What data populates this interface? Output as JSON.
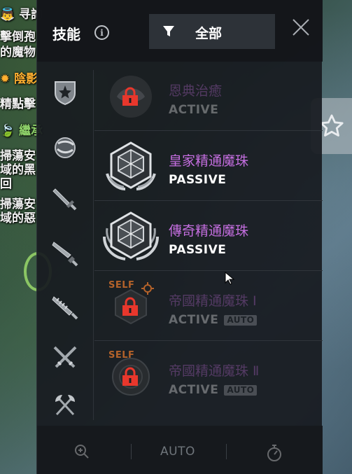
{
  "background": {
    "lines": [
      {
        "text": "👼 寻詢",
        "color": "white"
      },
      {
        "text": "擊倒孢",
        "color": "white"
      },
      {
        "text": "的魔物",
        "color": "white"
      },
      {
        "text": "✹ 陰影",
        "color": "orange"
      },
      {
        "text": "精點擊",
        "color": "white"
      },
      {
        "text": "🍃 繼承",
        "color": "green"
      },
      {
        "text": "掃蕩安",
        "color": "white"
      },
      {
        "text": "域的黑",
        "color": "white"
      },
      {
        "text": "回",
        "color": "white"
      },
      {
        "text": "掃蕩安",
        "color": "white"
      },
      {
        "text": "域的惡",
        "color": "white"
      }
    ]
  },
  "panel": {
    "title": "技能",
    "filter_label": "全部",
    "icons": {
      "info": "info-icon",
      "filter": "funnel-icon",
      "close": "close-icon",
      "side_tab": "star-icon"
    }
  },
  "categories": [
    {
      "name": "category-shield",
      "icon": "shield-icon"
    },
    {
      "name": "category-orb",
      "icon": "orb-icon"
    },
    {
      "name": "category-dagger",
      "icon": "dagger-icon"
    },
    {
      "name": "category-sword",
      "icon": "sword-icon"
    },
    {
      "name": "category-serrated-blade",
      "icon": "serrated-blade-icon"
    },
    {
      "name": "category-crossed-swords",
      "icon": "crossed-swords-icon"
    },
    {
      "name": "category-crossed-axes",
      "icon": "crossed-axes-icon"
    }
  ],
  "skills": [
    {
      "name": "恩典治癒",
      "type": "ACTIVE",
      "locked": true,
      "self": "",
      "auto": ""
    },
    {
      "name": "皇家精通魔珠",
      "type": "PASSIVE",
      "locked": false,
      "self": "",
      "auto": ""
    },
    {
      "name": "傳奇精通魔珠",
      "type": "PASSIVE",
      "locked": false,
      "self": "",
      "auto": ""
    },
    {
      "name": "帝國精通魔珠 Ⅰ",
      "type": "ACTIVE",
      "locked": true,
      "self": "SELF",
      "auto": "AUTO"
    },
    {
      "name": "帝國精通魔珠 Ⅱ",
      "type": "ACTIVE",
      "locked": true,
      "self": "SELF",
      "auto": "AUTO"
    }
  ],
  "footer": {
    "auto_label": "AUTO",
    "icons": {
      "zoom": "zoom-in-icon",
      "timer": "stopwatch-icon"
    }
  },
  "colors": {
    "panel_bg": "#181b20",
    "skill_name": "#c56ee0",
    "lock_red": "#e8372c",
    "self_tag": "#b4622a"
  }
}
